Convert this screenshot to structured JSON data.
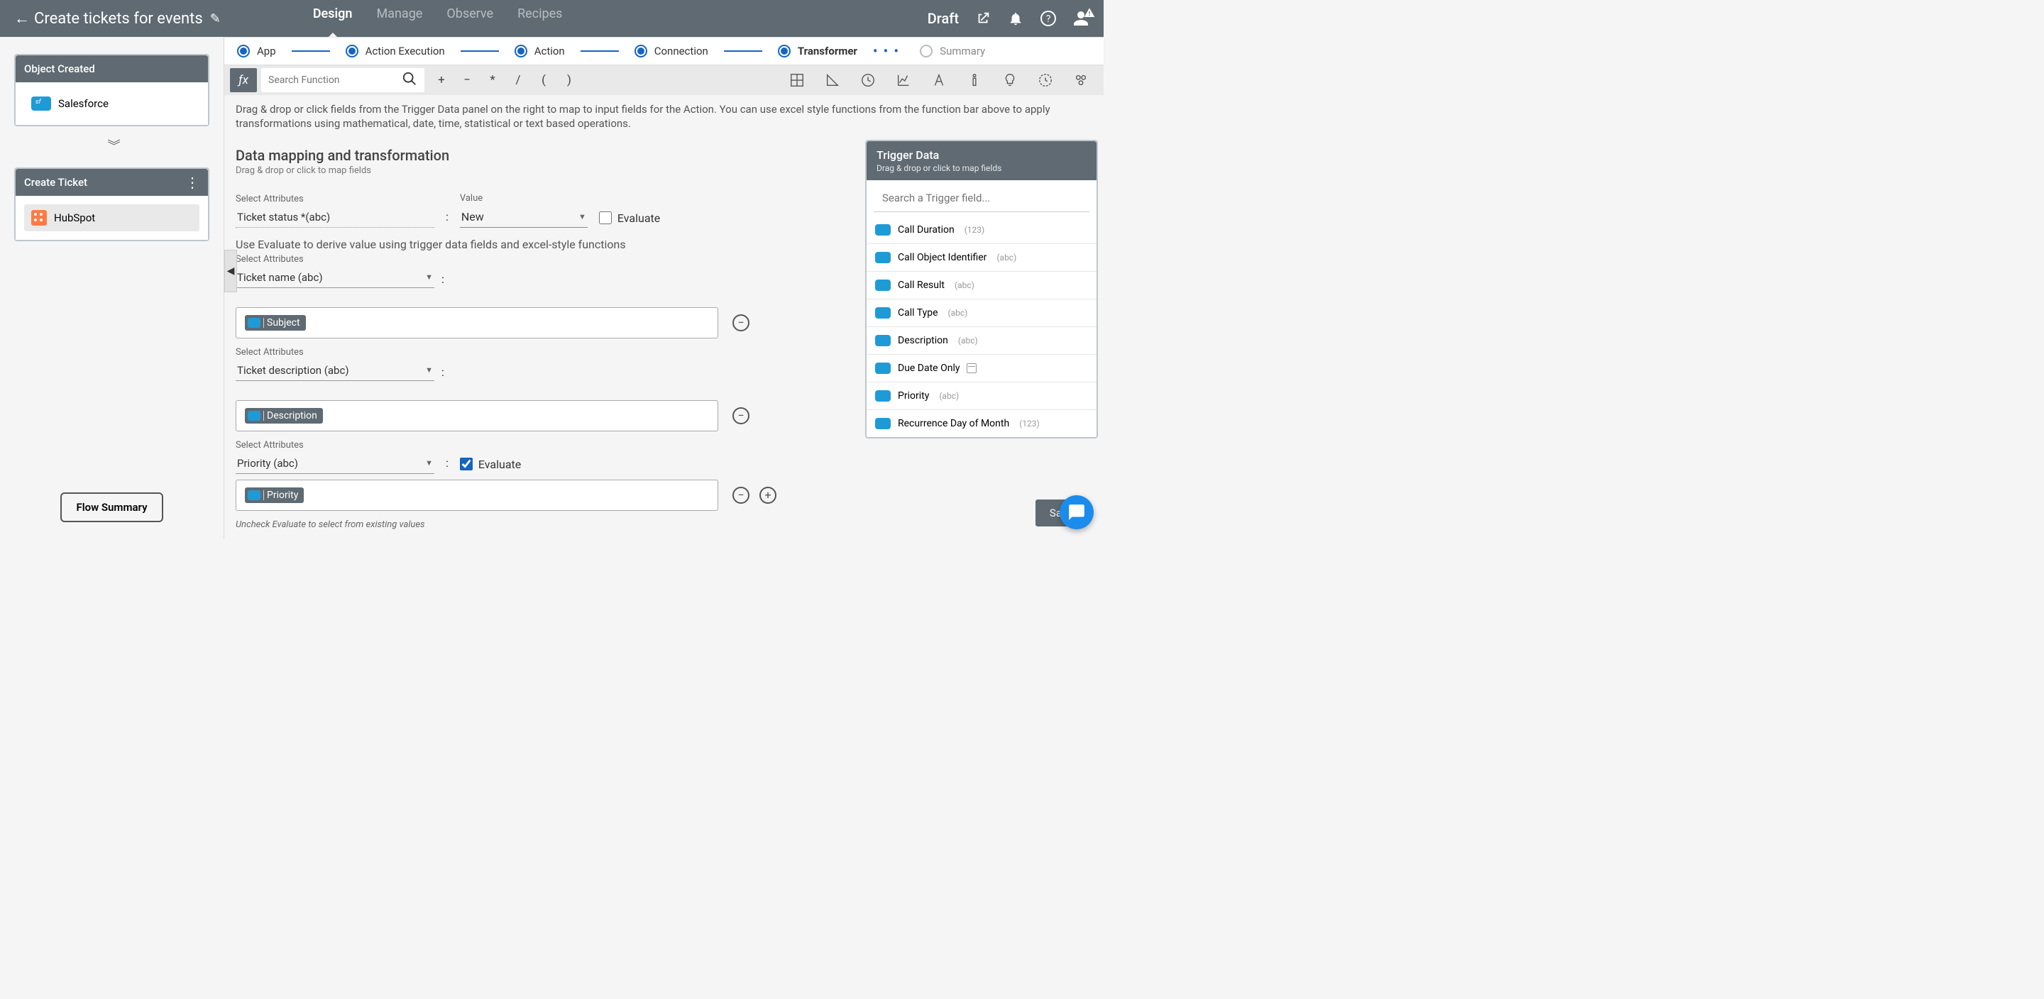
{
  "header": {
    "title": "Create tickets for events",
    "tabs": [
      "Design",
      "Manage",
      "Observe",
      "Recipes"
    ],
    "status": "Draft"
  },
  "sidebar": {
    "card1_title": "Object Created",
    "card1_app": "Salesforce",
    "card2_title": "Create Ticket",
    "card2_app": "HubSpot",
    "flow_summary": "Flow Summary"
  },
  "steps": [
    "App",
    "Action Execution",
    "Action",
    "Connection",
    "Transformer",
    "Summary"
  ],
  "funcbar": {
    "search_placeholder": "Search Function",
    "ops": [
      "+",
      "−",
      "*",
      "/",
      "(",
      ")"
    ]
  },
  "hint": "Drag & drop or click fields from the Trigger Data panel on the right to map to input fields for the Action. You can use excel style functions from the function bar above to apply transformations using mathematical, date, time, statistical or text based operations.",
  "mapping": {
    "title": "Data mapping and transformation",
    "subtitle": "Drag & drop or click to map fields",
    "select_attr_label": "Select Attributes",
    "value_label": "Value",
    "evaluate_label": "Evaluate",
    "evaluate_hint": "Use Evaluate to derive value using trigger data fields and excel-style functions",
    "uncheck_hint": "Uncheck Evaluate to select from existing values",
    "attr1": "Ticket status *(abc)",
    "value1": "New",
    "attr2": "Ticket name (abc)",
    "chip2": "Subject",
    "attr3": "Ticket description (abc)",
    "chip3": "Description",
    "attr4": "Priority (abc)",
    "chip4": "Priority"
  },
  "trigger": {
    "title": "Trigger Data",
    "subtitle": "Drag & drop or click to map fields",
    "search_placeholder": "Search a Trigger field...",
    "items": [
      {
        "name": "Call Duration",
        "type": "(123)"
      },
      {
        "name": "Call Object Identifier",
        "type": "(abc)"
      },
      {
        "name": "Call Result",
        "type": "(abc)"
      },
      {
        "name": "Call Type",
        "type": "(abc)"
      },
      {
        "name": "Description",
        "type": "(abc)"
      },
      {
        "name": "Due Date Only",
        "type": "_cal_"
      },
      {
        "name": "Priority",
        "type": "(abc)"
      },
      {
        "name": "Recurrence Day of Month",
        "type": "(123)"
      }
    ]
  },
  "save_label": "Save"
}
